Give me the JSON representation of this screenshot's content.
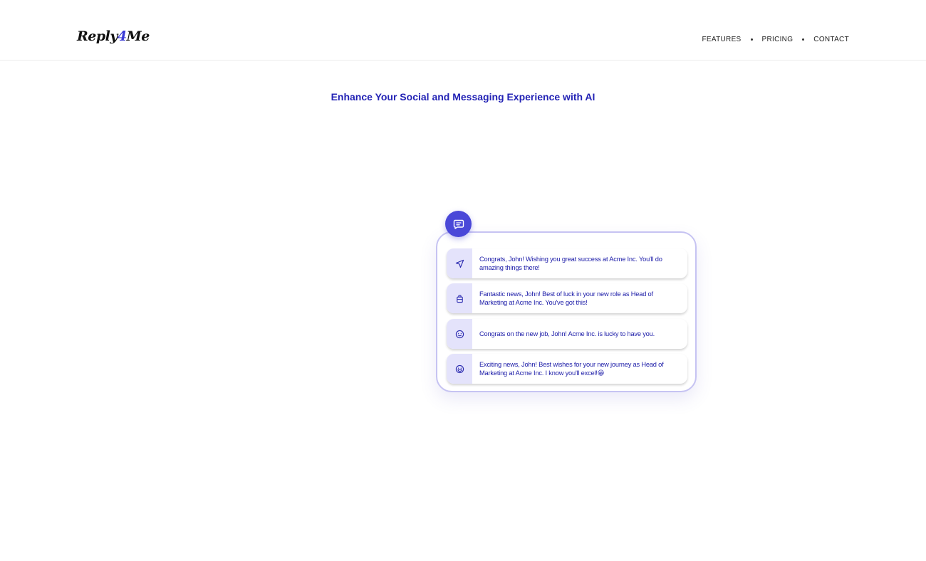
{
  "header": {
    "logo_prefix": "Reply",
    "logo_four": "4",
    "logo_suffix": "Me",
    "nav": [
      "FEATURES",
      "PRICING",
      "CONTACT"
    ]
  },
  "hero": {
    "headline": "Enhance Your Social and Messaging Experience with AI"
  },
  "suggestions": [
    {
      "icon": "send-icon",
      "text": "Congrats, John! Wishing you great success at Acme Inc. You'll do amazing things there!"
    },
    {
      "icon": "briefcase-icon",
      "text": "Fantastic news, John! Best of luck in your new role as Head of Marketing at Acme Inc. You've got this!"
    },
    {
      "icon": "smile-icon",
      "text": "Congrats on the new job, John! Acme Inc. is lucky to have you."
    },
    {
      "icon": "grin-icon",
      "text": "Exciting news, John! Best wishes for your new journey as Head of Marketing at Acme Inc. I know you'll excel!😀"
    }
  ],
  "colors": {
    "accent": "#4a48d8",
    "headline": "#2323b5",
    "text_blue": "#1c1ca8",
    "icon_bg": "#e4e3fb",
    "card_border": "#c6c3f2"
  }
}
